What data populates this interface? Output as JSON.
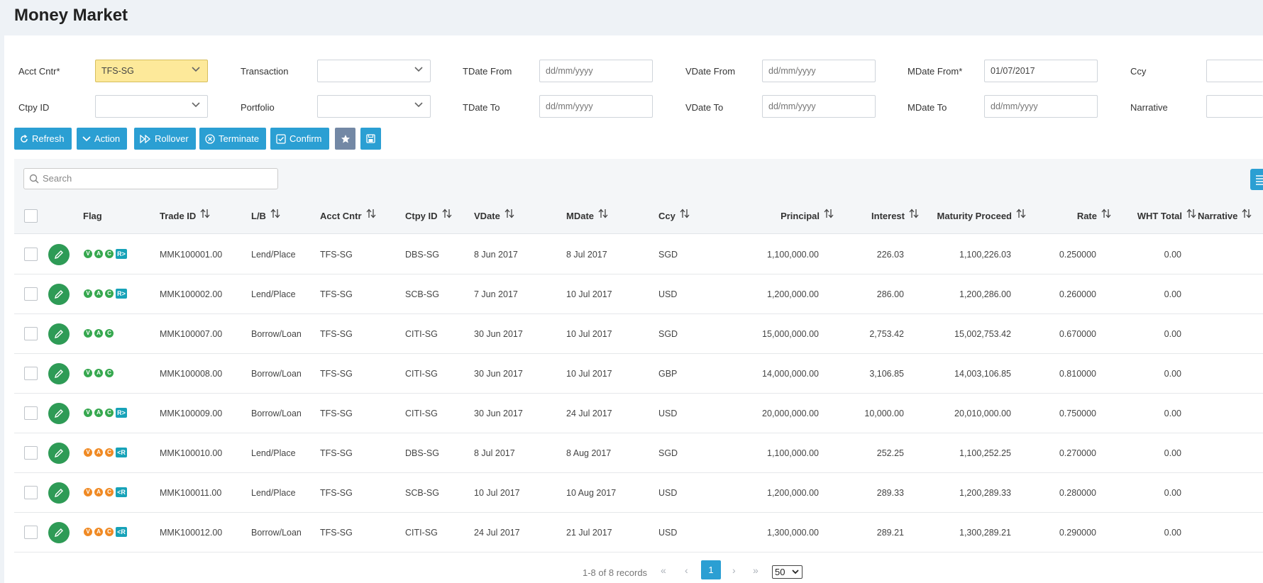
{
  "page": {
    "title": "Money Market"
  },
  "filters": {
    "acct_cntr": {
      "label": "Acct Cntr*",
      "value": "TFS-SG"
    },
    "transaction": {
      "label": "Transaction",
      "value": ""
    },
    "tdate_from": {
      "label": "TDate From",
      "placeholder": "dd/mm/yyyy"
    },
    "vdate_from": {
      "label": "VDate From",
      "placeholder": "dd/mm/yyyy"
    },
    "mdate_from": {
      "label": "MDate From*",
      "value": "01/07/2017"
    },
    "ccy": {
      "label": "Ccy",
      "value": ""
    },
    "ctpy_id": {
      "label": "Ctpy ID",
      "value": ""
    },
    "portfolio": {
      "label": "Portfolio",
      "value": ""
    },
    "tdate_to": {
      "label": "TDate To",
      "placeholder": "dd/mm/yyyy"
    },
    "vdate_to": {
      "label": "VDate To",
      "placeholder": "dd/mm/yyyy"
    },
    "mdate_to": {
      "label": "MDate To",
      "placeholder": "dd/mm/yyyy"
    },
    "narrative": {
      "label": "Narrative",
      "value": ""
    }
  },
  "toolbar": {
    "refresh": "Refresh",
    "action": "Action",
    "rollover": "Rollover",
    "terminate": "Terminate",
    "confirm": "Confirm"
  },
  "search": {
    "placeholder": "Search"
  },
  "table": {
    "headers": {
      "flag": "Flag",
      "trade_id": "Trade ID",
      "lb": "L/B",
      "acct_cntr": "Acct Cntr",
      "ctpy_id": "Ctpy ID",
      "vdate": "VDate",
      "mdate": "MDate",
      "ccy": "Ccy",
      "principal": "Principal",
      "interest": "Interest",
      "maturity": "Maturity Proceed",
      "rate": "Rate",
      "wht": "WHT Total",
      "narrative": "Narrative"
    },
    "rows": [
      {
        "flags": [
          "V",
          "A",
          "C",
          "R>"
        ],
        "flag_color": "green",
        "trade_id": "MMK100001.00",
        "lb": "Lend/Place",
        "acct_cntr": "TFS-SG",
        "ctpy_id": "DBS-SG",
        "vdate": "8 Jun 2017",
        "mdate": "8 Jul 2017",
        "ccy": "SGD",
        "principal": "1,100,000.00",
        "interest": "226.03",
        "maturity": "1,100,226.03",
        "rate": "0.250000",
        "wht": "0.00"
      },
      {
        "flags": [
          "V",
          "A",
          "C",
          "R>"
        ],
        "flag_color": "green",
        "trade_id": "MMK100002.00",
        "lb": "Lend/Place",
        "acct_cntr": "TFS-SG",
        "ctpy_id": "SCB-SG",
        "vdate": "7 Jun 2017",
        "mdate": "10 Jul 2017",
        "ccy": "USD",
        "principal": "1,200,000.00",
        "interest": "286.00",
        "maturity": "1,200,286.00",
        "rate": "0.260000",
        "wht": "0.00"
      },
      {
        "flags": [
          "V",
          "A",
          "C"
        ],
        "flag_color": "green",
        "trade_id": "MMK100007.00",
        "lb": "Borrow/Loan",
        "acct_cntr": "TFS-SG",
        "ctpy_id": "CITI-SG",
        "vdate": "30 Jun 2017",
        "mdate": "10 Jul 2017",
        "ccy": "SGD",
        "principal": "15,000,000.00",
        "interest": "2,753.42",
        "maturity": "15,002,753.42",
        "rate": "0.670000",
        "wht": "0.00"
      },
      {
        "flags": [
          "V",
          "A",
          "C"
        ],
        "flag_color": "green",
        "trade_id": "MMK100008.00",
        "lb": "Borrow/Loan",
        "acct_cntr": "TFS-SG",
        "ctpy_id": "CITI-SG",
        "vdate": "30 Jun 2017",
        "mdate": "10 Jul 2017",
        "ccy": "GBP",
        "principal": "14,000,000.00",
        "interest": "3,106.85",
        "maturity": "14,003,106.85",
        "rate": "0.810000",
        "wht": "0.00"
      },
      {
        "flags": [
          "V",
          "A",
          "C",
          "R>"
        ],
        "flag_color": "green",
        "trade_id": "MMK100009.00",
        "lb": "Borrow/Loan",
        "acct_cntr": "TFS-SG",
        "ctpy_id": "CITI-SG",
        "vdate": "30 Jun 2017",
        "mdate": "24 Jul 2017",
        "ccy": "USD",
        "principal": "20,000,000.00",
        "interest": "10,000.00",
        "maturity": "20,010,000.00",
        "rate": "0.750000",
        "wht": "0.00"
      },
      {
        "flags": [
          "V",
          "A",
          "C",
          "<R"
        ],
        "flag_color": "orange",
        "trade_id": "MMK100010.00",
        "lb": "Lend/Place",
        "acct_cntr": "TFS-SG",
        "ctpy_id": "DBS-SG",
        "vdate": "8 Jul 2017",
        "mdate": "8 Aug 2017",
        "ccy": "SGD",
        "principal": "1,100,000.00",
        "interest": "252.25",
        "maturity": "1,100,252.25",
        "rate": "0.270000",
        "wht": "0.00"
      },
      {
        "flags": [
          "V",
          "A",
          "C",
          "<R"
        ],
        "flag_color": "orange",
        "trade_id": "MMK100011.00",
        "lb": "Lend/Place",
        "acct_cntr": "TFS-SG",
        "ctpy_id": "SCB-SG",
        "vdate": "10 Jul 2017",
        "mdate": "10 Aug 2017",
        "ccy": "USD",
        "principal": "1,200,000.00",
        "interest": "289.33",
        "maturity": "1,200,289.33",
        "rate": "0.280000",
        "wht": "0.00"
      },
      {
        "flags": [
          "V",
          "A",
          "C",
          "<R"
        ],
        "flag_color": "orange",
        "trade_id": "MMK100012.00",
        "lb": "Borrow/Loan",
        "acct_cntr": "TFS-SG",
        "ctpy_id": "CITI-SG",
        "vdate": "24 Jul 2017",
        "mdate": "21 Jul 2017",
        "ccy": "USD",
        "principal": "1,300,000.00",
        "interest": "289.21",
        "maturity": "1,300,289.21",
        "rate": "0.290000",
        "wht": "0.00"
      }
    ]
  },
  "pagination": {
    "summary": "1-8 of 8 records",
    "current_page": "1",
    "page_size": "50"
  },
  "colors": {
    "primary": "#2b9fd3",
    "edit_green": "#2e9b56",
    "flag_green": "#36a84f",
    "flag_orange": "#f08a24",
    "flag_teal": "#17a2b8",
    "highlight": "#fde99a"
  }
}
